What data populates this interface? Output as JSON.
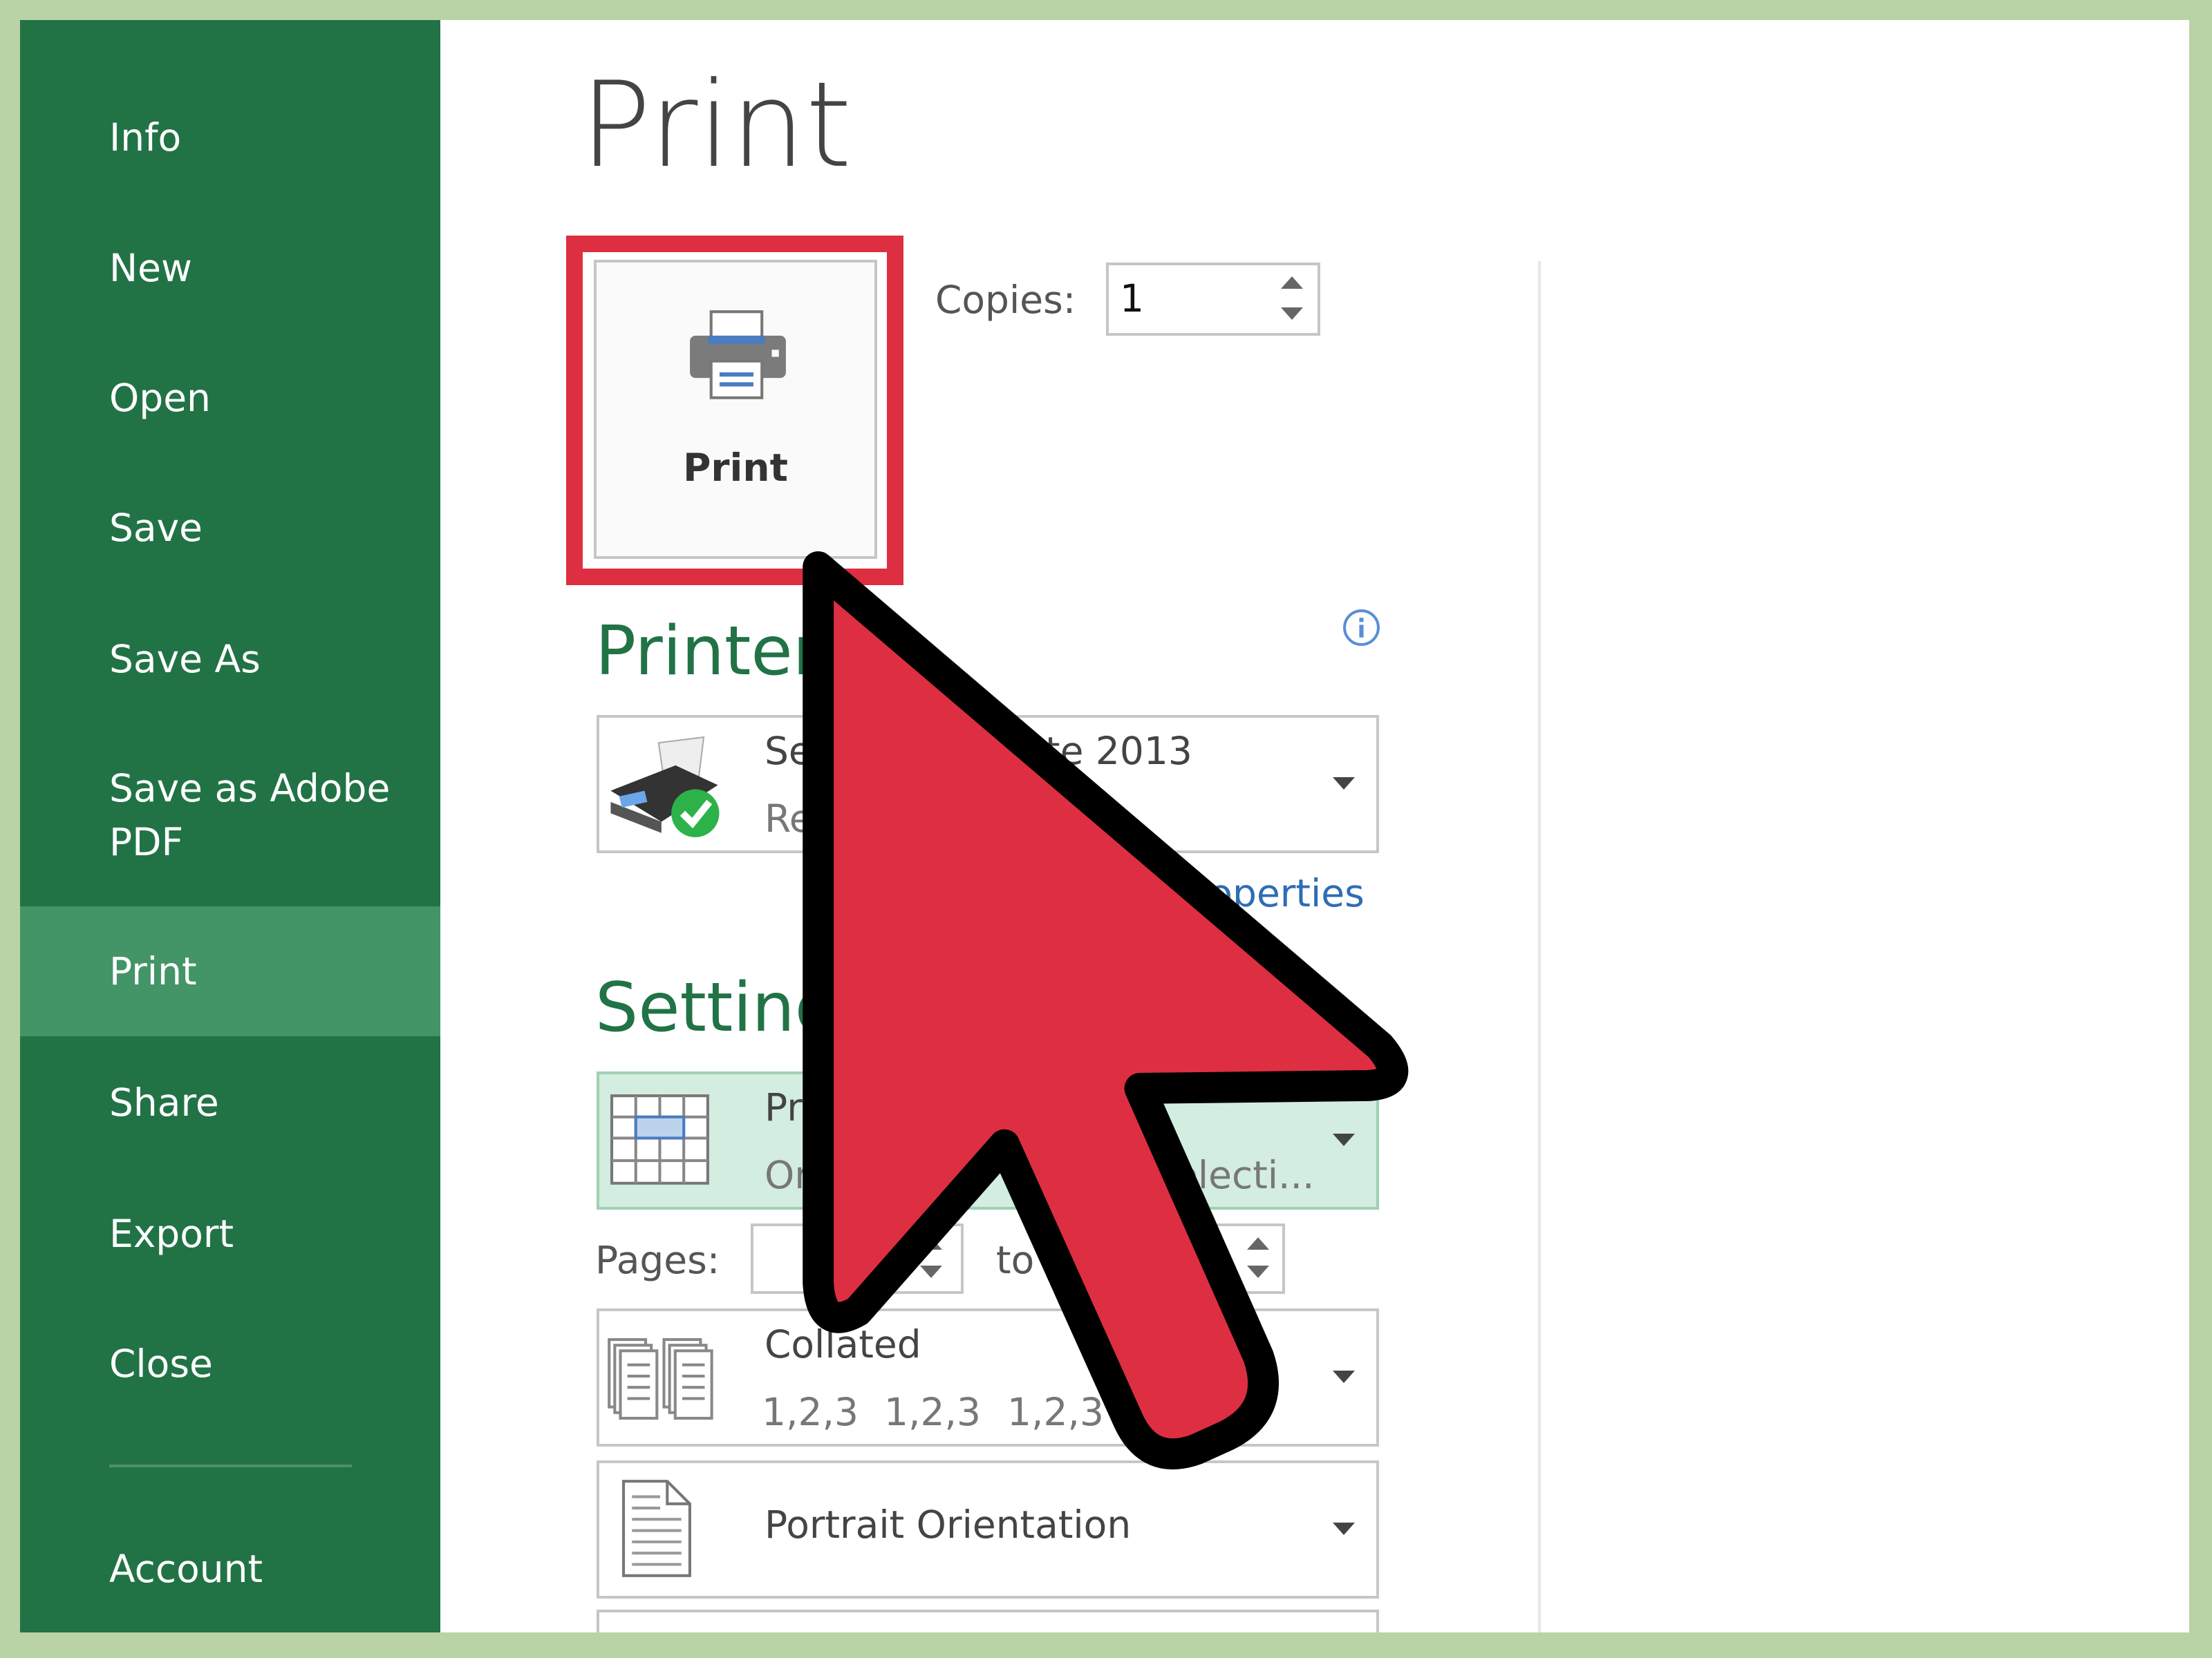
{
  "sidebar": {
    "items": [
      {
        "label": "Info"
      },
      {
        "label": "New"
      },
      {
        "label": "Open"
      },
      {
        "label": "Save"
      },
      {
        "label": "Save As"
      },
      {
        "label": "Save as Adobe PDF"
      },
      {
        "label": "Print",
        "selected": true
      },
      {
        "label": "Share"
      },
      {
        "label": "Export"
      },
      {
        "label": "Close"
      },
      {
        "label": "Account"
      }
    ],
    "colors": {
      "background": "#217346",
      "selected": "#439467"
    }
  },
  "main": {
    "title": "Print",
    "print_button": {
      "label": "Print",
      "icon": "printer-icon",
      "highlight_color": "#dd2f41"
    },
    "copies": {
      "label": "Copies:",
      "value": "1"
    },
    "printer": {
      "heading": "Printer",
      "name_visible_start": "Se",
      "name_visible_end": "te 2013",
      "status_visible": "Re",
      "properties_link": "roperties",
      "info_icon": "info-icon"
    },
    "settings": {
      "heading": "Setting",
      "print_what": {
        "title_visible": "Pr",
        "sub_visible_start": "Or",
        "sub_visible_mid": "e",
        "sub_visible_end": "electi..."
      },
      "pages_label": "Pages:",
      "to_label": "to",
      "collation": {
        "title": "Collated",
        "sequence": [
          "1,2,3",
          "1,2,3",
          "1,2,3"
        ]
      },
      "orientation": {
        "title": "Portrait Orientation"
      }
    }
  },
  "overlay": {
    "arrow_icon": "cursor-arrow-icon",
    "fill": "#dd2f41",
    "stroke": "#000000"
  }
}
